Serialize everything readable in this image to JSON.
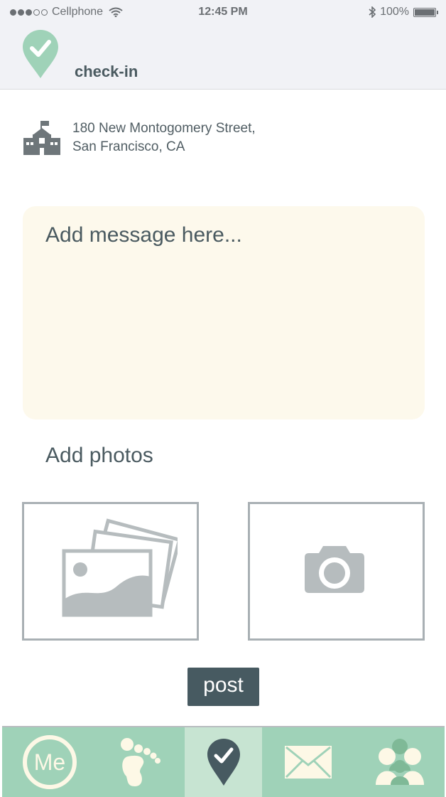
{
  "status_bar": {
    "carrier": "Cellphone",
    "time": "12:45 PM",
    "battery": "100%",
    "battery_level": 1.0
  },
  "header": {
    "title": "check-in",
    "pin_icon": "check-pin-icon"
  },
  "location": {
    "icon": "school-building-icon",
    "address_line1": "180 New Montogomery Street,",
    "address_line2": "San Francisco, CA"
  },
  "message": {
    "placeholder": "Add message here...",
    "value": ""
  },
  "photos": {
    "label": "Add photos",
    "gallery_icon": "photo-gallery-icon",
    "camera_icon": "camera-icon"
  },
  "post_button": {
    "label": "post"
  },
  "tab_bar": {
    "tabs": [
      {
        "id": "me",
        "label": "Me",
        "icon": "me-circle-icon"
      },
      {
        "id": "footprints",
        "icon": "footprint-icon"
      },
      {
        "id": "checkin",
        "icon": "check-pin-icon",
        "active": true
      },
      {
        "id": "messages",
        "icon": "envelope-icon"
      },
      {
        "id": "people",
        "icon": "people-icon"
      }
    ]
  },
  "colors": {
    "accent_green": "#9fd2b8",
    "active_tab": "#c7e4d2",
    "dark_slate": "#475a61",
    "message_bg": "#fdf9ec",
    "icon_gray": "#b6bcbe",
    "cream": "#fdf8e6"
  }
}
